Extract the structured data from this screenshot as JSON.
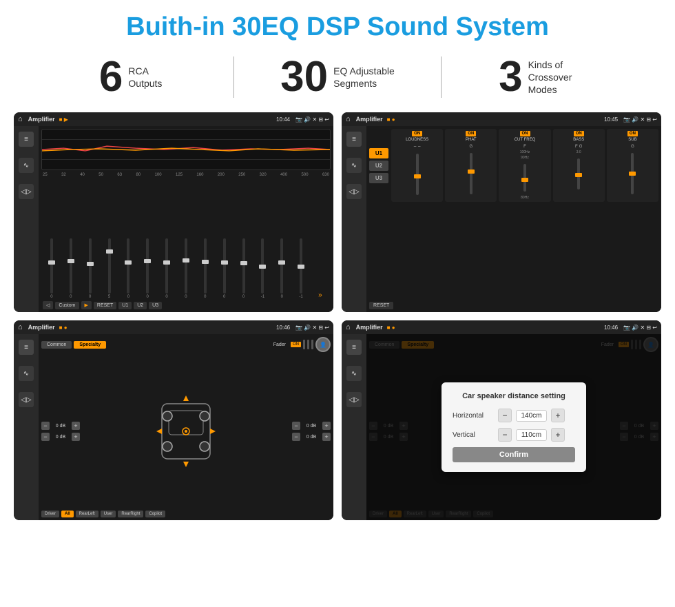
{
  "page": {
    "title": "Buith-in 30EQ DSP Sound System",
    "stats": [
      {
        "number": "6",
        "label": "RCA\nOutputs"
      },
      {
        "number": "30",
        "label": "EQ Adjustable\nSegments"
      },
      {
        "number": "3",
        "label": "Kinds of\nCrossover Modes"
      }
    ],
    "screens": [
      {
        "id": "eq-screen",
        "topbar": {
          "title": "Amplifier",
          "time": "10:44"
        },
        "type": "eq"
      },
      {
        "id": "dsp-screen",
        "topbar": {
          "title": "Amplifier",
          "time": "10:45"
        },
        "type": "dsp"
      },
      {
        "id": "crossover-screen",
        "topbar": {
          "title": "Amplifier",
          "time": "10:46"
        },
        "type": "crossover"
      },
      {
        "id": "distance-screen",
        "topbar": {
          "title": "Amplifier",
          "time": "10:46"
        },
        "type": "distance"
      }
    ],
    "eq": {
      "presets": [
        "Custom",
        "RESET",
        "U1",
        "U2",
        "U3"
      ],
      "frequencies": [
        "25",
        "32",
        "40",
        "50",
        "63",
        "80",
        "100",
        "125",
        "160",
        "200",
        "250",
        "320",
        "400",
        "500",
        "630"
      ],
      "values": [
        "0",
        "0",
        "0",
        "5",
        "0",
        "0",
        "0",
        "0",
        "0",
        "0",
        "0",
        "-1",
        "0",
        "-1"
      ]
    },
    "dsp": {
      "u_buttons": [
        "U1",
        "U2",
        "U3"
      ],
      "controls": [
        "LOUDNESS",
        "PHAT",
        "CUT FREQ",
        "BASS",
        "SUB"
      ]
    },
    "crossover": {
      "tabs": [
        "Common",
        "Specialty"
      ],
      "fader_label": "Fader",
      "db_labels": [
        "0 dB",
        "0 dB",
        "0 dB",
        "0 dB"
      ],
      "bottom_buttons": [
        "Driver",
        "RearLeft",
        "All",
        "User",
        "RearRight",
        "Copilot"
      ]
    },
    "distance": {
      "modal": {
        "title": "Car speaker distance setting",
        "horizontal_label": "Horizontal",
        "horizontal_value": "140cm",
        "vertical_label": "Vertical",
        "vertical_value": "110cm",
        "confirm_label": "Confirm"
      },
      "bottom_buttons": [
        "Driver",
        "RearLeft",
        "All",
        "User",
        "RearRight",
        "Copilot"
      ]
    }
  }
}
